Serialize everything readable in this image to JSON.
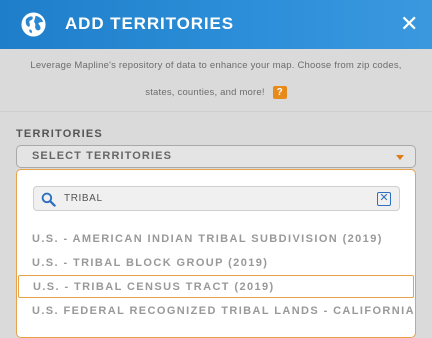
{
  "header": {
    "title": "ADD TERRITORIES",
    "logo_icon": "globe-icon",
    "close_icon": "close-icon",
    "close_label": "✕",
    "background_color": "#2a88d2"
  },
  "description": {
    "line1": "Leverage Mapline's repository of data to enhance your map. Choose from zip codes,",
    "line2": "states, counties, and more!",
    "help_label": "?",
    "help_color": "#e88a1a"
  },
  "territories": {
    "label": "TERRITORIES",
    "select_label": "SELECT TERRITORIES",
    "accent_color": "#e07b15"
  },
  "search": {
    "value": "TRIBAL",
    "clear_label": "✕"
  },
  "options": [
    {
      "label": "U.S. - AMERICAN INDIAN TRIBAL SUBDIVISION (2019)",
      "selected": false
    },
    {
      "label": "U.S. - TRIBAL BLOCK GROUP (2019)",
      "selected": false
    },
    {
      "label": "U.S. - TRIBAL CENSUS TRACT (2019)",
      "selected": true
    },
    {
      "label": "U.S. FEDERAL RECOGNIZED TRIBAL LANDS - CALIFORNIA",
      "selected": false
    }
  ]
}
